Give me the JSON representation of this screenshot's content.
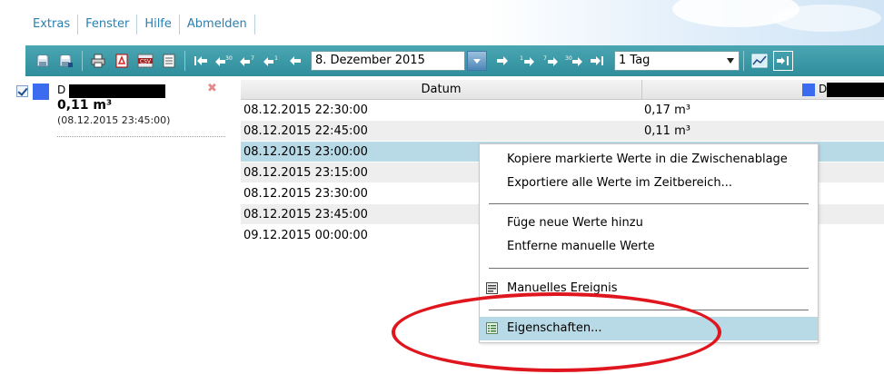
{
  "menu": [
    "Extras",
    "Fenster",
    "Hilfe",
    "Abmelden"
  ],
  "toolbar": {
    "date_value": "8. Dezember 2015",
    "range_value": "1 Tag",
    "icons": [
      "save-icon",
      "save-as-icon",
      "print-icon",
      "pdf-icon",
      "csv-icon",
      "report-icon",
      "first-icon",
      "back-30-icon",
      "back-7-icon",
      "back-1-icon",
      "prev-icon",
      "calendar-dropdown-icon",
      "next-icon",
      "forward-1-icon",
      "forward-7-icon",
      "forward-30-icon",
      "last-icon",
      "chart-icon",
      "expand-icon"
    ]
  },
  "legend": {
    "checked": true,
    "swatch_color": "#3b6cf0",
    "name_prefix": "D",
    "value": "0,11 m³",
    "timestamp": "(08.12.2015 23:45:00)",
    "remove_glyph": "✖"
  },
  "table": {
    "col_datum": "Datum",
    "col_series_prefix": "D",
    "rows": [
      {
        "datum": "08.12.2015 22:30:00",
        "value": "0,17 m³"
      },
      {
        "datum": "08.12.2015 22:45:00",
        "value": "0,11 m³"
      },
      {
        "datum": "08.12.2015 23:00:00",
        "value": ""
      },
      {
        "datum": "08.12.2015 23:15:00",
        "value": ""
      },
      {
        "datum": "08.12.2015 23:30:00",
        "value": ""
      },
      {
        "datum": "08.12.2015 23:45:00",
        "value": ""
      },
      {
        "datum": "09.12.2015 00:00:00",
        "value": ""
      }
    ]
  },
  "context_menu": {
    "copy": "Kopiere markierte Werte in die Zwischenablage",
    "export": "Exportiere alle Werte im Zeitbereich...",
    "add": "Füge neue Werte hinzu",
    "remove": "Entferne manuelle Werte",
    "manual_event": "Manuelles Ereignis",
    "properties": "Eigenschaften..."
  },
  "colors": {
    "toolbar": "#2f8d9c",
    "menu_link": "#2a7fb0",
    "selection": "#b8d9e6",
    "annotation": "#e0161f"
  }
}
